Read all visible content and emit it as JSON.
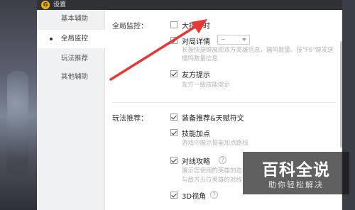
{
  "window": {
    "title": "设置"
  },
  "sidebar": {
    "items": [
      {
        "label": "基本辅助"
      },
      {
        "label": "全局监控"
      },
      {
        "label": "玩法推荐"
      },
      {
        "label": "其他辅助"
      }
    ]
  },
  "global_monitor": {
    "section_label": "全局监控：",
    "ult_timer": {
      "label": "大招计时",
      "checked": false
    },
    "match_details": {
      "label": "对局详情",
      "checked": true,
      "select_value": "~",
      "desc": "长按快捷键展现双方英雄信息，擂鸣数量。按\"F6\"键发送擂鸣数量信息"
    },
    "ally_hint": {
      "label": "友方提示",
      "checked": true,
      "desc": "友方一级技能提示"
    }
  },
  "gameplay": {
    "section_label": "玩法推荐：",
    "equipment": {
      "label": "装备推荐&天赋符文",
      "checked": true
    },
    "skill_points": {
      "label": "技能加点",
      "checked": true,
      "desc": "游戏中展示技能加点路线"
    },
    "lane_guide": {
      "label": "对线攻略",
      "checked": true,
      "help": "?",
      "desc_line1": "展示您使用的英雄的造",
      "desc_line2": "与敌方五位英雄的对线"
    },
    "view_3d": {
      "label": "3D视角",
      "checked": true,
      "help": "?"
    }
  },
  "watermark": {
    "main": "百科全说",
    "sub": "助你轻松解决"
  },
  "colors": {
    "arrow": "#e53935",
    "titlebar": "#2f3136",
    "sidebar": "#f0f1f3",
    "desc_text": "#b5b5b5"
  }
}
